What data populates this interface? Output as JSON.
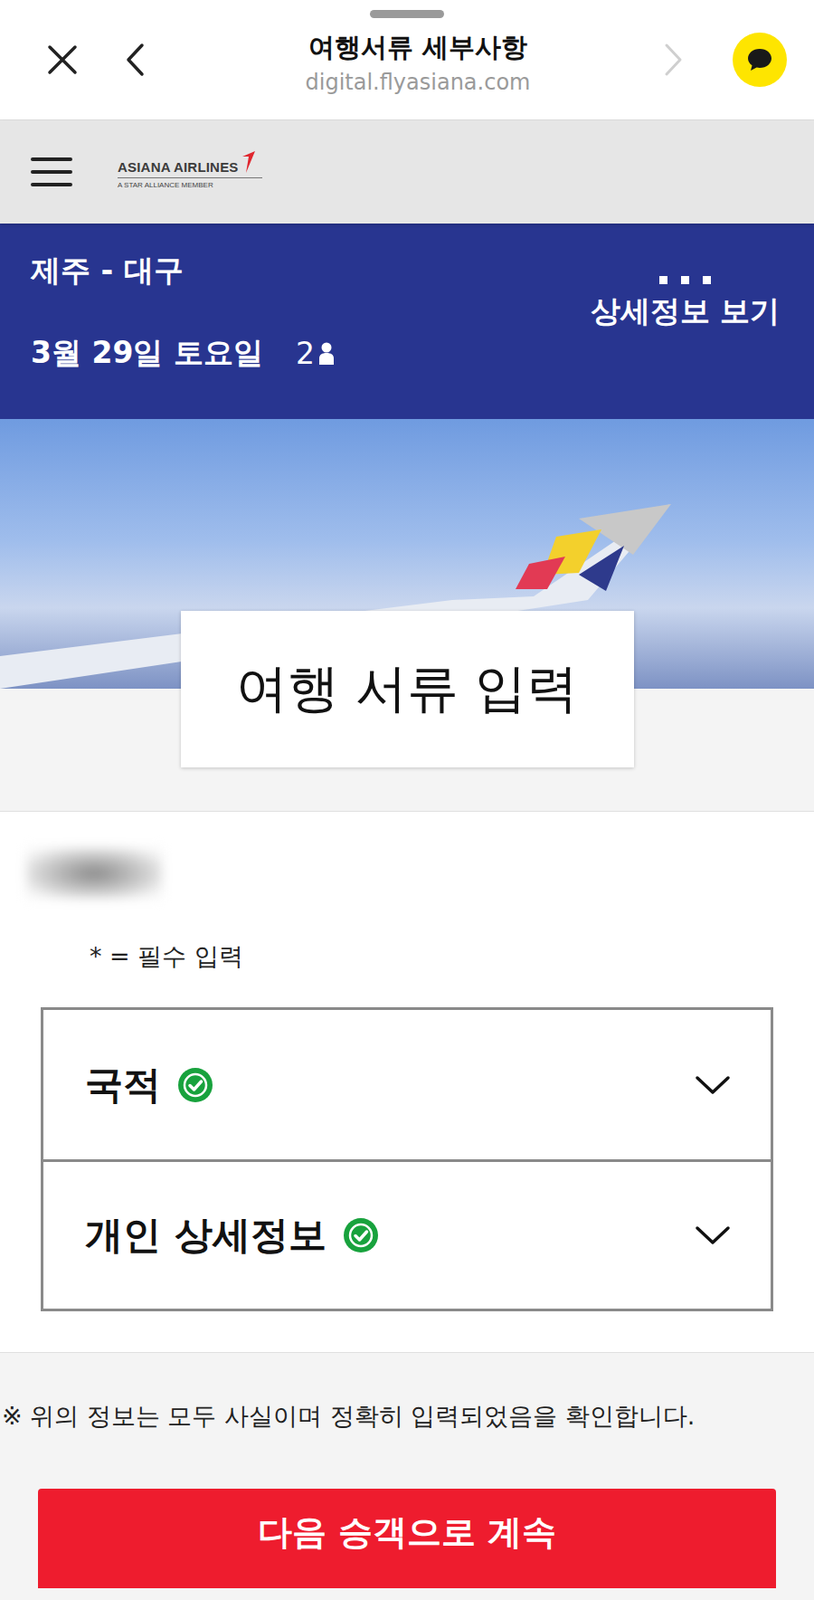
{
  "header": {
    "title": "여행서류 세부사항",
    "url": "digital.flyasiana.com",
    "back_disabled": false,
    "forward_disabled": true
  },
  "logo": {
    "name": "ASIANA AIRLINES",
    "tagline": "A STAR ALLIANCE MEMBER"
  },
  "trip": {
    "route": "제주 - 대구",
    "date": "3월 29일 토요일",
    "passengers": "2",
    "details_link": "상세정보 보기"
  },
  "page_title": "여행 서류 입력",
  "form": {
    "required_note": "* = 필수 입력",
    "sections": [
      {
        "label": "국적",
        "complete": true,
        "expanded": false
      },
      {
        "label": "개인 상세정보",
        "complete": true,
        "expanded": false
      }
    ]
  },
  "confirmation": "※ 위의 정보는 모두 사실이며 정확히 입력되었음을 확인합니다.",
  "primary_button": "다음 승객으로 계속"
}
